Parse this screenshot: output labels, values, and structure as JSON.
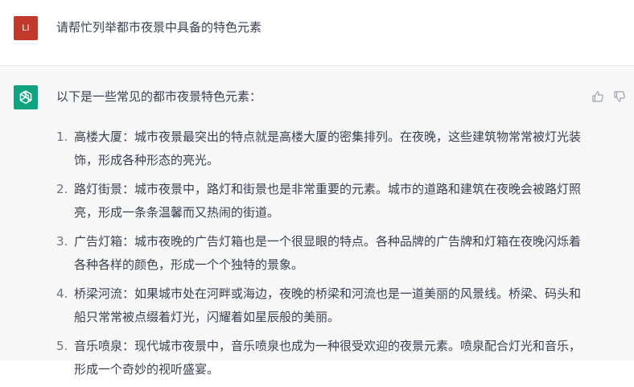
{
  "user": {
    "avatar_initials": "LI",
    "message": "请帮忙列举都市夜景中具备的特色元素"
  },
  "assistant": {
    "intro": "以下是一些常见的都市夜景特色元素：",
    "items": [
      {
        "num": "1.",
        "text": "高楼大厦：城市夜景最突出的特点就是高楼大厦的密集排列。在夜晚，这些建筑物常常被灯光装饰，形成各种形态的亮光。"
      },
      {
        "num": "2.",
        "text": "路灯街景：城市夜景中，路灯和街景也是非常重要的元素。城市的道路和建筑在夜晚会被路灯照亮，形成一条条温馨而又热闹的街道。"
      },
      {
        "num": "3.",
        "text": "广告灯箱：城市夜晚的广告灯箱也是一个很显眼的特点。各种品牌的广告牌和灯箱在夜晚闪烁着各种各样的颜色，形成一个个独特的景象。"
      },
      {
        "num": "4.",
        "text": "桥梁河流：如果城市处在河畔或海边，夜晚的桥梁和河流也是一道美丽的风景线。桥梁、码头和船只常常被点缀着灯光，闪耀着如星辰般的美丽。"
      },
      {
        "num": "5.",
        "text": "音乐喷泉：现代城市夜景中，音乐喷泉也成为一种很受欢迎的夜景元素。喷泉配合灯光和音乐，形成一个奇妙的视听盛宴。"
      }
    ]
  },
  "colors": {
    "user_avatar": "#c0392b",
    "assistant_avatar": "#10a37f",
    "assistant_bg": "#f7f7f8"
  }
}
